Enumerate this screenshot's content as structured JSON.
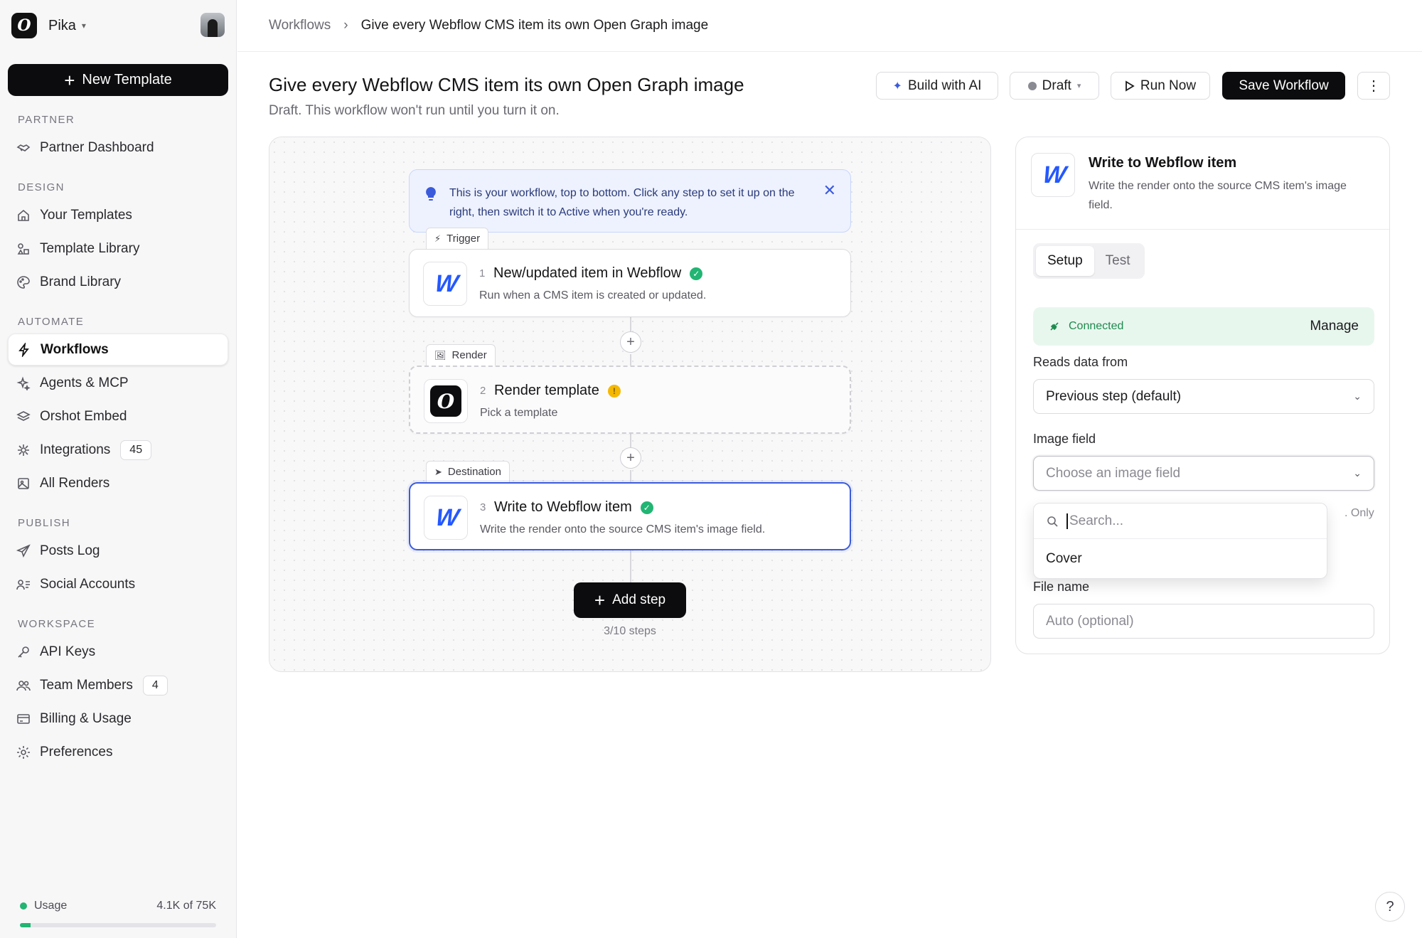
{
  "workspace": {
    "name": "Pika"
  },
  "sidebar": {
    "new_template": "New Template",
    "sections": [
      {
        "title": "PARTNER",
        "items": [
          {
            "label": "Partner Dashboard",
            "icon": "handshake-icon"
          }
        ]
      },
      {
        "title": "DESIGN",
        "items": [
          {
            "label": "Your Templates",
            "icon": "home-icon"
          },
          {
            "label": "Template Library",
            "icon": "shapes-icon"
          },
          {
            "label": "Brand Library",
            "icon": "palette-icon"
          }
        ]
      },
      {
        "title": "AUTOMATE",
        "items": [
          {
            "label": "Workflows",
            "icon": "bolt-icon",
            "active": true
          },
          {
            "label": "Agents & MCP",
            "icon": "sparkles-icon"
          },
          {
            "label": "Orshot Embed",
            "icon": "layers-icon"
          },
          {
            "label": "Integrations",
            "icon": "plug-icon",
            "badge": "45"
          },
          {
            "label": "All Renders",
            "icon": "image-icon"
          }
        ]
      },
      {
        "title": "PUBLISH",
        "items": [
          {
            "label": "Posts Log",
            "icon": "send-icon"
          },
          {
            "label": "Social Accounts",
            "icon": "users-list-icon"
          }
        ]
      },
      {
        "title": "WORKSPACE",
        "items": [
          {
            "label": "API Keys",
            "icon": "key-icon"
          },
          {
            "label": "Team Members",
            "icon": "team-icon",
            "badge": "4"
          },
          {
            "label": "Billing & Usage",
            "icon": "card-icon"
          },
          {
            "label": "Preferences",
            "icon": "gear-icon"
          }
        ]
      }
    ],
    "usage": {
      "label": "Usage",
      "value": "4.1K of 75K",
      "fraction": 0.055
    }
  },
  "breadcrumb": {
    "parent": "Workflows",
    "current": "Give every Webflow CMS item its own Open Graph image"
  },
  "header": {
    "title": "Give every Webflow CMS item its own Open Graph image",
    "subtitle": "Draft. This workflow won't run until you turn it on.",
    "build_ai": "Build with AI",
    "status": "Draft",
    "run_now": "Run Now",
    "save": "Save Workflow"
  },
  "canvas": {
    "info": "This is your workflow, top to bottom. Click any step to set it up on the right, then switch it to Active when you're ready.",
    "steps": [
      {
        "tag": "Trigger",
        "num": "1",
        "title": "New/updated item in Webflow",
        "desc": "Run when a CMS item is created or updated.",
        "status": "ok"
      },
      {
        "tag": "Render",
        "num": "2",
        "title": "Render template",
        "desc": "Pick a template",
        "status": "warning"
      },
      {
        "tag": "Destination",
        "num": "3",
        "title": "Write to Webflow item",
        "desc": "Write the render onto the source CMS item's image field.",
        "status": "ok"
      }
    ],
    "add_step": "Add step",
    "step_count": "3/10 steps"
  },
  "panel": {
    "title": "Write to Webflow item",
    "desc": "Write the render onto the source CMS item's image field.",
    "tabs": [
      "Setup",
      "Test"
    ],
    "active_tab": "Setup",
    "connected": "Connected",
    "manage": "Manage",
    "reads_label": "Reads data from",
    "reads_value": "Previous step (default)",
    "image_label": "Image field",
    "image_placeholder": "Choose an image field",
    "only_hint": ". Only",
    "file_label": "File name",
    "file_placeholder": "Auto (optional)",
    "dropdown": {
      "search_placeholder": "Search...",
      "options": [
        "Cover"
      ]
    }
  },
  "help": "?"
}
